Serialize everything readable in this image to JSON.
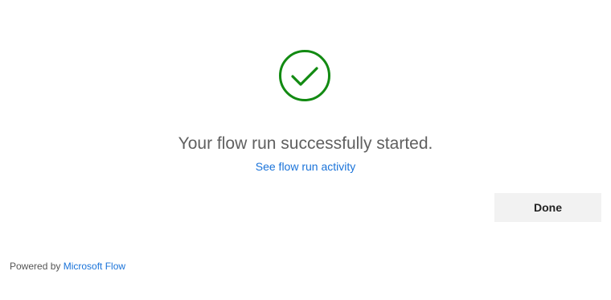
{
  "status": {
    "icon": "checkmark-circle-icon",
    "icon_color": "#128a12",
    "message": "Your flow run successfully started.",
    "activity_link": "See flow run activity"
  },
  "actions": {
    "done_label": "Done"
  },
  "footer": {
    "powered_by": "Powered by",
    "brand_link": "Microsoft Flow"
  },
  "colors": {
    "link": "#1a73d9",
    "button_bg": "#f2f2f2",
    "message_text": "#606060"
  }
}
